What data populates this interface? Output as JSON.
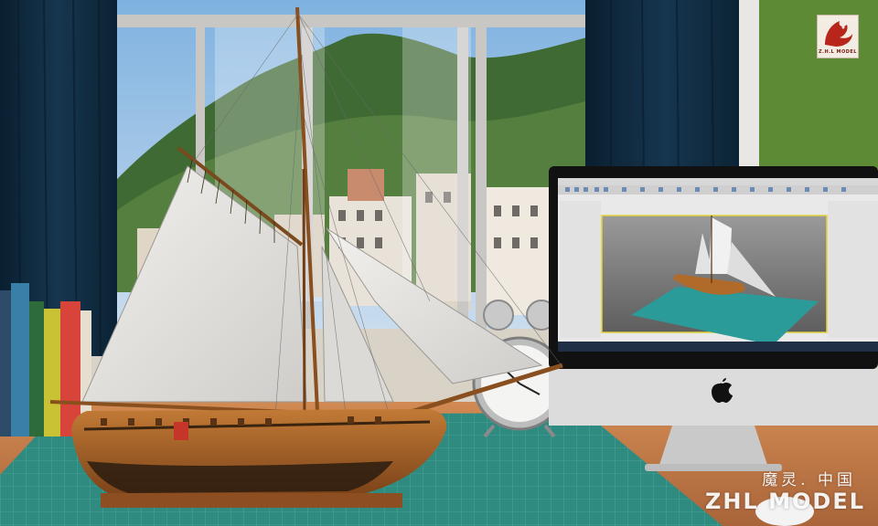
{
  "watermark": {
    "chinese": "魔灵. 中国",
    "english": "ZHL MODEL"
  },
  "logo": {
    "caption": "Z.H.L MODEL"
  },
  "colors": {
    "curtain": "#0f2a3f",
    "wall_green": "#5c8a35",
    "desk_wood": "#c07a45",
    "cutting_mat": "#2f8a80",
    "sail": "#e8e6e2",
    "hull": "#b06a2a"
  },
  "icons": [
    "apple-logo-icon",
    "alarm-clock-icon",
    "zhl-logo-icon"
  ]
}
